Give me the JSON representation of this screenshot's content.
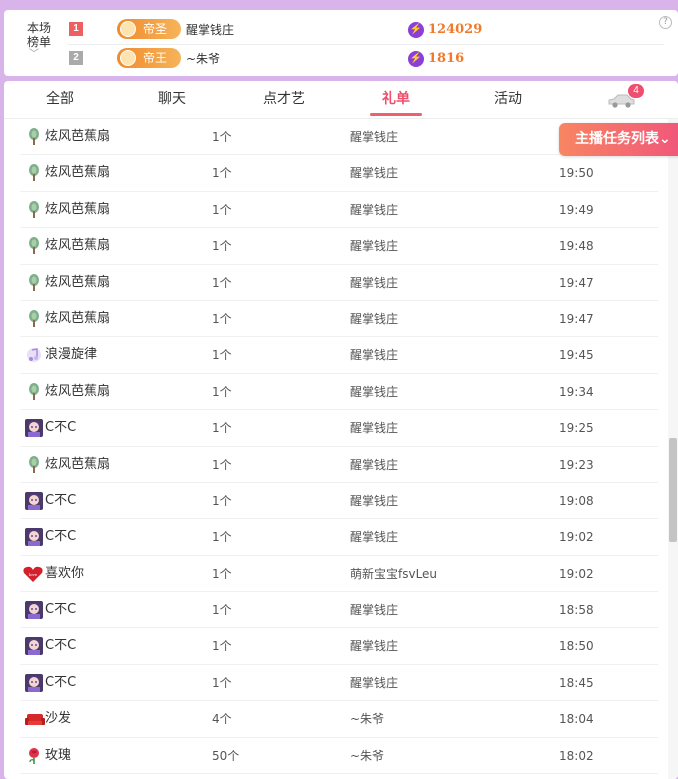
{
  "rank_board": {
    "label_line1": "本场",
    "label_line2": "榜单",
    "expand_glyph": "﹀",
    "help_glyph": "?",
    "entries": [
      {
        "position": "1",
        "title": "帝圣",
        "name": "醒掌钱庄",
        "score": "124029"
      },
      {
        "position": "2",
        "title": "帝王",
        "name": "~朱爷",
        "score": "1816"
      }
    ]
  },
  "tabs": [
    {
      "label": "全部"
    },
    {
      "label": "聊天"
    },
    {
      "label": "点才艺"
    },
    {
      "label": "礼单",
      "active": true
    },
    {
      "label": "活动"
    }
  ],
  "car_badge_count": "4",
  "task_button_label": "主播任务列表",
  "gifts": [
    {
      "icon": "fan-icon",
      "name": "炫风芭蕉扇",
      "count": "1个",
      "sender": "醒掌钱庄",
      "time": ""
    },
    {
      "icon": "fan-icon",
      "name": "炫风芭蕉扇",
      "count": "1个",
      "sender": "醒掌钱庄",
      "time": "19:50"
    },
    {
      "icon": "fan-icon",
      "name": "炫风芭蕉扇",
      "count": "1个",
      "sender": "醒掌钱庄",
      "time": "19:49"
    },
    {
      "icon": "fan-icon",
      "name": "炫风芭蕉扇",
      "count": "1个",
      "sender": "醒掌钱庄",
      "time": "19:48"
    },
    {
      "icon": "fan-icon",
      "name": "炫风芭蕉扇",
      "count": "1个",
      "sender": "醒掌钱庄",
      "time": "19:47"
    },
    {
      "icon": "fan-icon",
      "name": "炫风芭蕉扇",
      "count": "1个",
      "sender": "醒掌钱庄",
      "time": "19:47"
    },
    {
      "icon": "melody-icon",
      "name": "浪漫旋律",
      "count": "1个",
      "sender": "醒掌钱庄",
      "time": "19:45"
    },
    {
      "icon": "fan-icon",
      "name": "炫风芭蕉扇",
      "count": "1个",
      "sender": "醒掌钱庄",
      "time": "19:34"
    },
    {
      "icon": "anime-avatar-icon",
      "name": "C不C",
      "count": "1个",
      "sender": "醒掌钱庄",
      "time": "19:25"
    },
    {
      "icon": "fan-icon",
      "name": "炫风芭蕉扇",
      "count": "1个",
      "sender": "醒掌钱庄",
      "time": "19:23"
    },
    {
      "icon": "anime-avatar-icon",
      "name": "C不C",
      "count": "1个",
      "sender": "醒掌钱庄",
      "time": "19:08"
    },
    {
      "icon": "anime-avatar-icon",
      "name": "C不C",
      "count": "1个",
      "sender": "醒掌钱庄",
      "time": "19:02"
    },
    {
      "icon": "heart-icon",
      "name": "喜欢你",
      "count": "1个",
      "sender": "萌新宝宝fsvLeu",
      "time": "19:02"
    },
    {
      "icon": "anime-avatar-icon",
      "name": "C不C",
      "count": "1个",
      "sender": "醒掌钱庄",
      "time": "18:58"
    },
    {
      "icon": "anime-avatar-icon",
      "name": "C不C",
      "count": "1个",
      "sender": "醒掌钱庄",
      "time": "18:50"
    },
    {
      "icon": "anime-avatar-icon",
      "name": "C不C",
      "count": "1个",
      "sender": "醒掌钱庄",
      "time": "18:45"
    },
    {
      "icon": "sofa-icon",
      "name": "沙发",
      "count": "4个",
      "sender": "~朱爷",
      "time": "18:04"
    },
    {
      "icon": "rose-icon",
      "name": "玫瑰",
      "count": "50个",
      "sender": "~朱爷",
      "time": "18:02"
    }
  ],
  "colors": {
    "accent": "#ee4f6a",
    "background": "#d8b4ea",
    "score": "#f07a2a",
    "badge_orange": "#f08a2c"
  }
}
